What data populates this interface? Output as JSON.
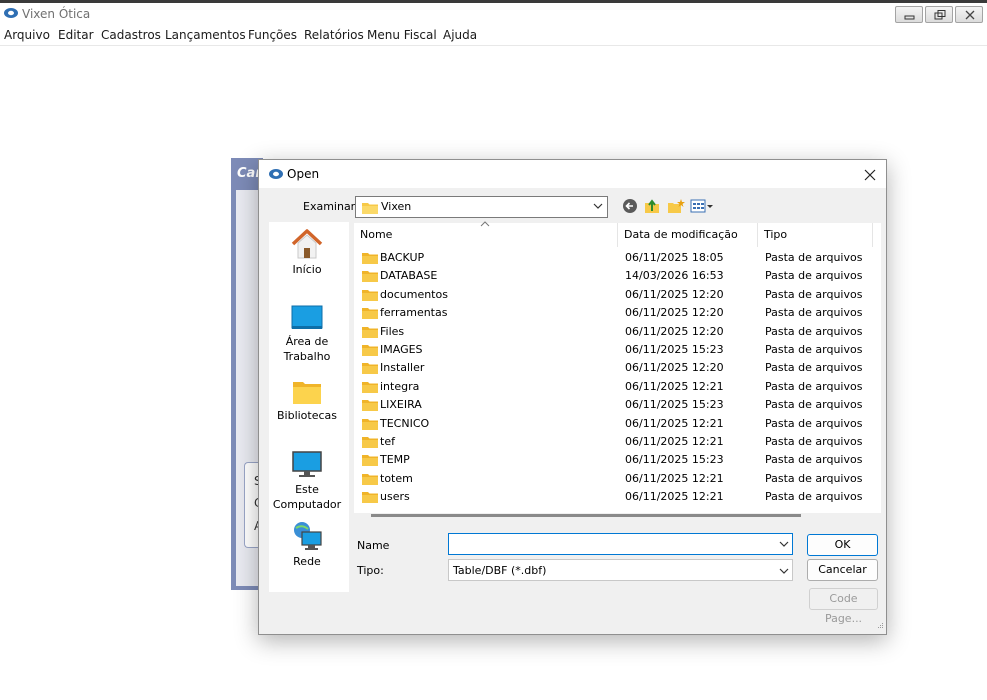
{
  "app": {
    "title": "Vixen Ótica",
    "menu": [
      "Arquivo",
      "Editar",
      "Cadastros",
      "Lançamentos",
      "Funções",
      "Relatórios",
      "Menu Fiscal",
      "Ajuda"
    ]
  },
  "background_window": {
    "title_fragment": "Car",
    "letters": [
      "S",
      "C",
      "A"
    ]
  },
  "dialog": {
    "title": "Open",
    "look_in_label": "Examinar:",
    "look_in_value": "Vixen",
    "places": [
      "Início",
      "Área de Trabalho",
      "Bibliotecas",
      "Este Computador",
      "Rede"
    ],
    "columns": [
      "Nome",
      "Data de modificação",
      "Tipo"
    ],
    "files": [
      {
        "name": "BACKUP",
        "date": "06/11/2025 18:05",
        "type": "Pasta de arquivos"
      },
      {
        "name": "DATABASE",
        "date": "14/03/2026 16:53",
        "type": "Pasta de arquivos"
      },
      {
        "name": "documentos",
        "date": "06/11/2025 12:20",
        "type": "Pasta de arquivos"
      },
      {
        "name": "ferramentas",
        "date": "06/11/2025 12:20",
        "type": "Pasta de arquivos"
      },
      {
        "name": "Files",
        "date": "06/11/2025 12:20",
        "type": "Pasta de arquivos"
      },
      {
        "name": "IMAGES",
        "date": "06/11/2025 15:23",
        "type": "Pasta de arquivos"
      },
      {
        "name": "Installer",
        "date": "06/11/2025 12:20",
        "type": "Pasta de arquivos"
      },
      {
        "name": "integra",
        "date": "06/11/2025 12:21",
        "type": "Pasta de arquivos"
      },
      {
        "name": "LIXEIRA",
        "date": "06/11/2025 15:23",
        "type": "Pasta de arquivos"
      },
      {
        "name": "TECNICO",
        "date": "06/11/2025 12:21",
        "type": "Pasta de arquivos"
      },
      {
        "name": "tef",
        "date": "06/11/2025 12:21",
        "type": "Pasta de arquivos"
      },
      {
        "name": "TEMP",
        "date": "06/11/2025 15:23",
        "type": "Pasta de arquivos"
      },
      {
        "name": "totem",
        "date": "06/11/2025 12:21",
        "type": "Pasta de arquivos"
      },
      {
        "name": "users",
        "date": "06/11/2025 12:21",
        "type": "Pasta de arquivos"
      }
    ],
    "name_label": "Name",
    "name_value": "",
    "type_label": "Tipo:",
    "type_value": "Table/DBF (*.dbf)",
    "ok_label": "OK",
    "cancel_label": "Cancelar",
    "codepage_label": "Code Page..."
  },
  "colors": {
    "folder": "#f7c948",
    "accent": "#0078d4",
    "bg_window_title": "#7d8bb7"
  }
}
